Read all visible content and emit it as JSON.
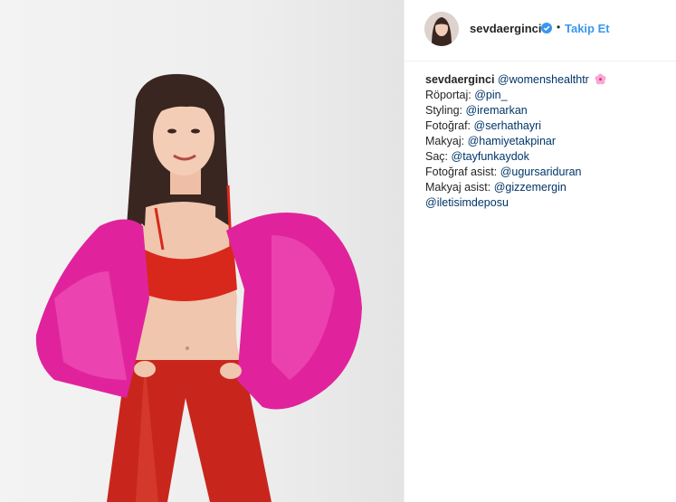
{
  "post": {
    "username": "sevdaerginci",
    "separator": "•",
    "follow_label": "Takip Et",
    "verified_icon": "verified-badge-icon",
    "accent_color": "#3897f0",
    "mention_color": "#003569"
  },
  "caption": {
    "author": "sevdaerginci",
    "first_mention": "@womenshealthtr",
    "emoji_icon": "cherry-blossom-icon",
    "lines": [
      {
        "label": "Röportaj:",
        "mention": "@pin_"
      },
      {
        "label": "Styling:",
        "mention": "@iremarkan"
      },
      {
        "label": "Fotoğraf:",
        "mention": "@serhathayri"
      },
      {
        "label": "Makyaj:",
        "mention": "@hamiyetakpinar"
      },
      {
        "label": "Saç:",
        "mention": "@tayfunkaydok"
      },
      {
        "label": "Fotoğraf asist:",
        "mention": "@ugursariduran"
      },
      {
        "label": "Makyaj asist:",
        "mention": "@gizzemergin"
      }
    ],
    "last_mention": "@iletisimdeposu"
  }
}
